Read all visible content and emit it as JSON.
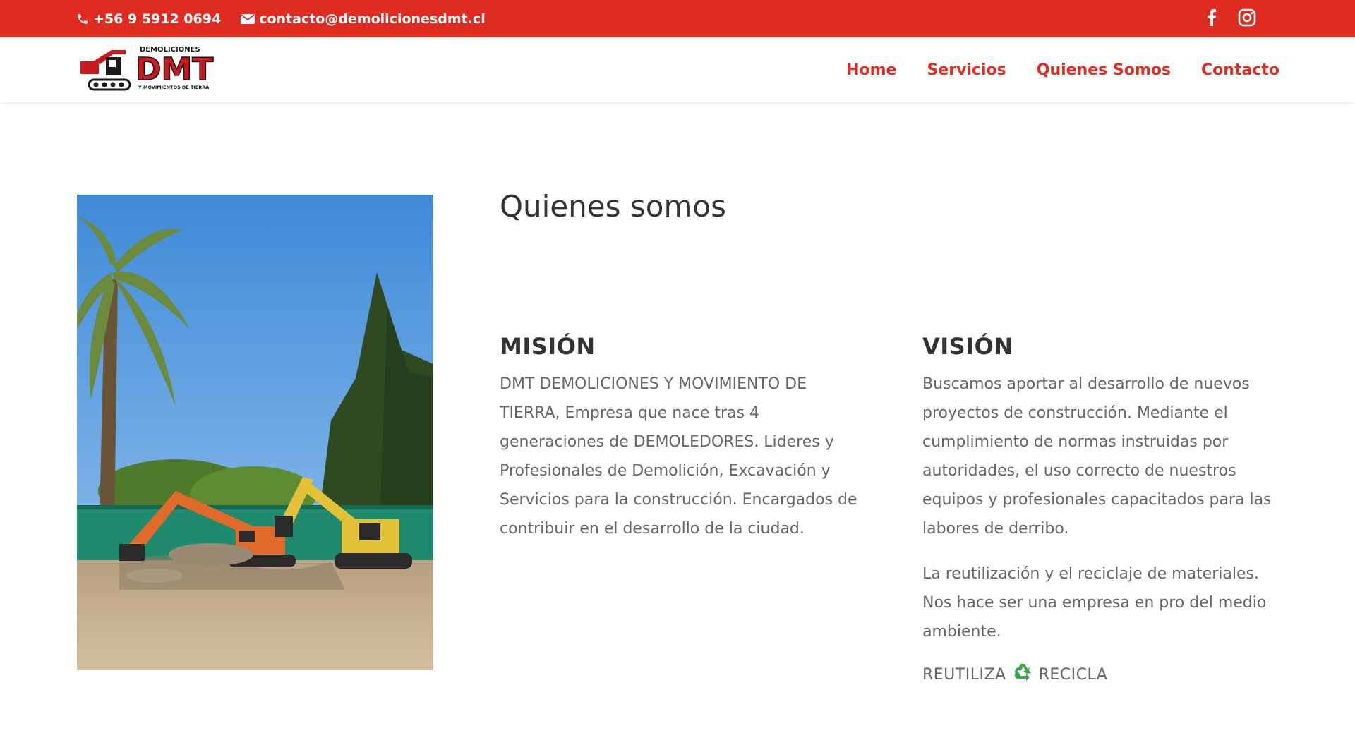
{
  "topbar": {
    "phone": "+56 9 5912 0694",
    "email": "contacto@demolicionesdmt.cl",
    "social_icons": [
      "facebook-icon",
      "instagram-icon"
    ],
    "color": "#e02b20"
  },
  "header": {
    "logo": {
      "top_text": "DEMOLICIONES",
      "main_text": "DMT",
      "bottom_text": "Y MOVIMIENTOS DE TIERRA"
    },
    "nav": [
      {
        "label": "Home"
      },
      {
        "label": "Servicios"
      },
      {
        "label": "Quienes Somos"
      },
      {
        "label": "Contacto"
      }
    ]
  },
  "main": {
    "title": "Quienes somos",
    "mision": {
      "heading": "MISIÓN",
      "text": "DMT DEMOLICIONES Y MOVIMIENTO DE TIERRA, Empresa que nace tras 4 generaciones de DEMOLEDORES. Lideres y Profesionales de Demolición, Excavación y Servicios para la construcción. Encargados de contribuir en el desarrollo de la ciudad."
    },
    "vision": {
      "heading": "VISIÓN",
      "paragraph1": "Buscamos aportar al desarrollo de nuevos proyectos de construcción. Mediante el cumplimiento de normas instruidas por autoridades, el uso correcto de nuestros equipos y profesionales capacitados para las labores de derribo.",
      "paragraph2": "La reutilización y el reciclaje de materiales. Nos hace ser una empresa en pro del medio ambiente.",
      "slogan_left": "REUTILIZA",
      "slogan_icon": "recycle-icon",
      "slogan_right": "RECICLA"
    }
  },
  "colors": {
    "accent": "#e02b20",
    "heading": "#333333",
    "body_text": "#666666",
    "recycle_green": "#3aa54a"
  }
}
